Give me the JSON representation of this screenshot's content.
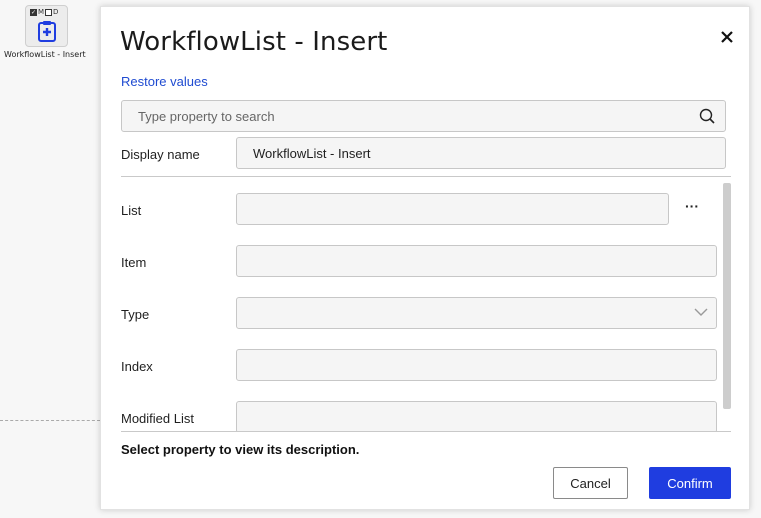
{
  "canvas": {
    "node": {
      "flag_m": "M",
      "flag_d": "D",
      "label": "WorkflowList - Insert",
      "icon": "clipboard-plus-icon"
    }
  },
  "dialog": {
    "title": "WorkflowList - Insert",
    "close_icon": "close-icon",
    "restore_label": "Restore values",
    "search": {
      "placeholder": "Type property to search",
      "icon": "search-icon"
    },
    "display_name": {
      "label": "Display name",
      "value": "WorkflowList - Insert"
    },
    "properties": [
      {
        "label": "List",
        "value": ""
      },
      {
        "label": "Item",
        "value": ""
      },
      {
        "label": "Type",
        "value": ""
      },
      {
        "label": "Index",
        "value": ""
      },
      {
        "label": "Modified List",
        "value": ""
      }
    ],
    "list_more_label": "···",
    "description": "Select property to view its description.",
    "cancel_label": "Cancel",
    "confirm_label": "Confirm"
  },
  "colors": {
    "accent": "#1f3de0",
    "link": "#1f4bd1"
  }
}
